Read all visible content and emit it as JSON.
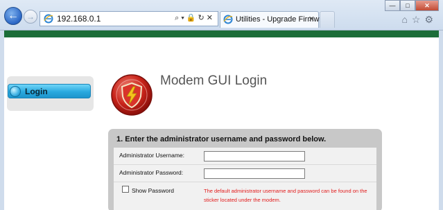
{
  "browser": {
    "address": "192.168.0.1",
    "address_tools": "⌕▾🔒↻✕",
    "tab_title": "Utilities - Upgrade Firmware",
    "tab_close": "✕",
    "back_glyph": "←",
    "forward_glyph": "→",
    "window_buttons": [
      "—",
      "□",
      "✕"
    ],
    "right_tools": "⌂☆⚙"
  },
  "sidebar": {
    "items": [
      {
        "label": "Login",
        "icon": "globe-icon"
      }
    ]
  },
  "page": {
    "title": "Modem GUI Login",
    "logo_icon": "shield-lightning-icon"
  },
  "login_panel": {
    "heading": "1. Enter the administrator username and password below.",
    "username_label": "Administrator Username:",
    "username_value": "",
    "password_label": "Administrator Password:",
    "password_value": "",
    "show_password_label": "Show Password",
    "note": "The default administrator username and password can be found on the sticker located under the modem."
  },
  "colors": {
    "header_bar": "#1b6d38",
    "sidebar_active": "#2aa9df",
    "panel_bg": "#c8c8c8",
    "note_text": "#e21b1b"
  }
}
